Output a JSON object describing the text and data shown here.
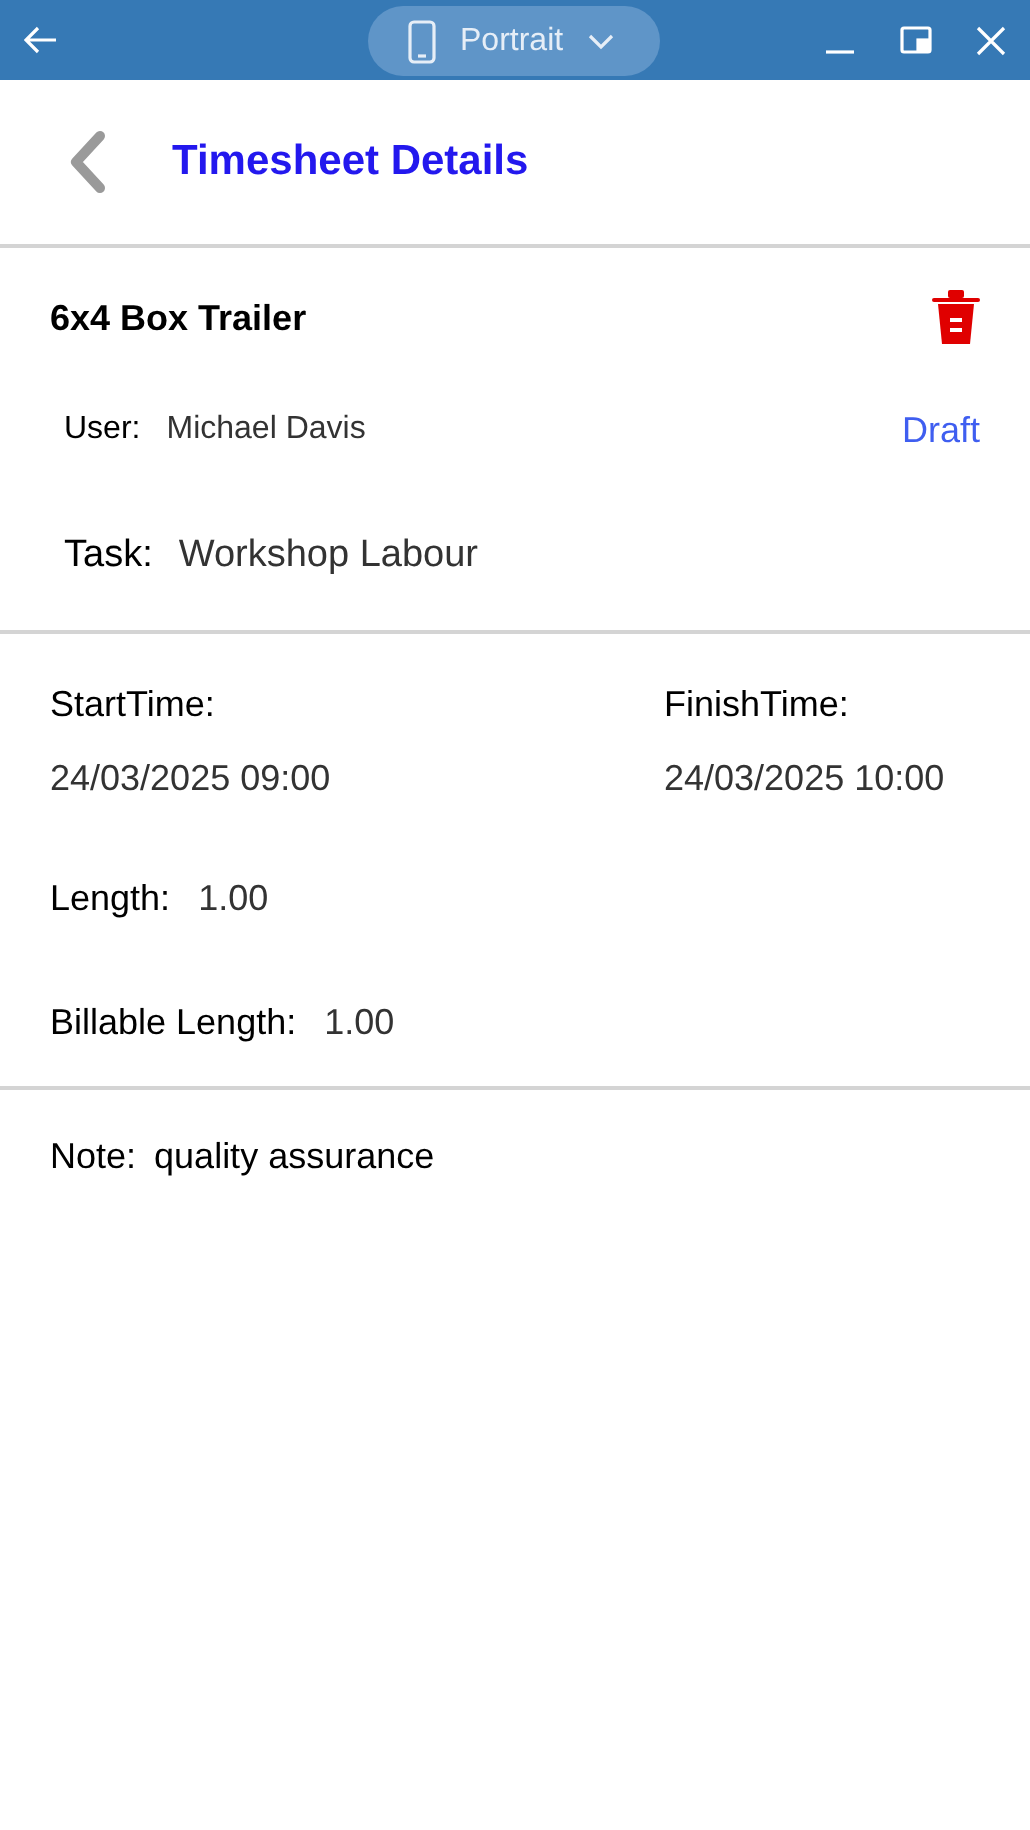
{
  "window": {
    "mode": "Portrait"
  },
  "header": {
    "title": "Timesheet Details"
  },
  "summary": {
    "title": "6x4 Box Trailer",
    "user": {
      "label": "User:",
      "value": "Michael Davis"
    },
    "status": "Draft",
    "task": {
      "label": "Task:",
      "value": "Workshop Labour"
    }
  },
  "times": {
    "start": {
      "label": "StartTime:",
      "value": "24/03/2025 09:00"
    },
    "finish": {
      "label": "FinishTime:",
      "value": "24/03/2025 10:00"
    },
    "fields": [
      {
        "label": "Length:",
        "value": "1.00"
      },
      {
        "label": "Billable Length:",
        "value": "1.00"
      }
    ]
  },
  "note": {
    "label": "Note:",
    "value": "quality assurance"
  }
}
